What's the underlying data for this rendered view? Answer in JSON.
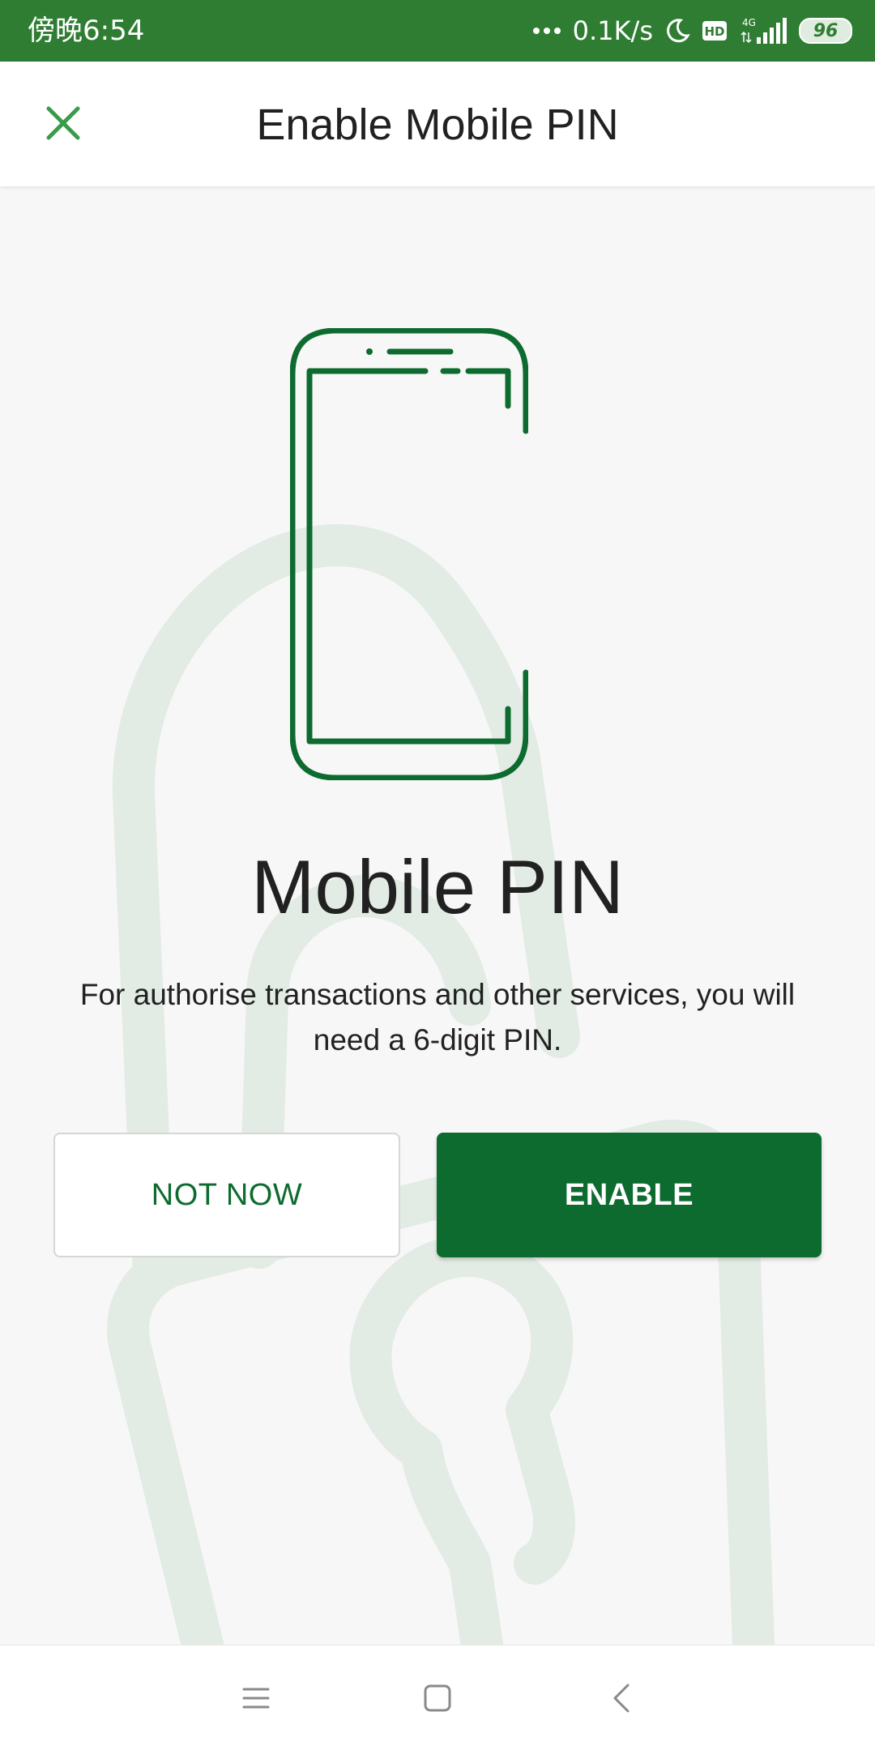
{
  "status_bar": {
    "time": "傍晚6:54",
    "network_speed": "0.1K/s",
    "network_type": "4G",
    "hd_badge": "HD",
    "battery": "96",
    "icons": [
      "moon-icon",
      "hd-icon",
      "signal-icon",
      "battery-icon"
    ]
  },
  "app_bar": {
    "title": "Enable Mobile PIN",
    "close_icon": "close-icon"
  },
  "main": {
    "illustration": "smartphone-outline",
    "background_watermark": "padlock",
    "heading": "Mobile PIN",
    "description": "For authorise transactions and other services, you will need a 6-digit PIN.",
    "buttons": {
      "secondary": "NOT NOW",
      "primary": "ENABLE"
    }
  },
  "nav_bar": {
    "icons": [
      "menu-icon",
      "home-icon",
      "back-icon"
    ]
  },
  "colors": {
    "status_bar": "#2e7d32",
    "accent": "#0e6b2f",
    "close_icon": "#3a9b4a",
    "background": "#f7f7f7",
    "watermark": "#e2ebe4",
    "text": "#212121"
  }
}
